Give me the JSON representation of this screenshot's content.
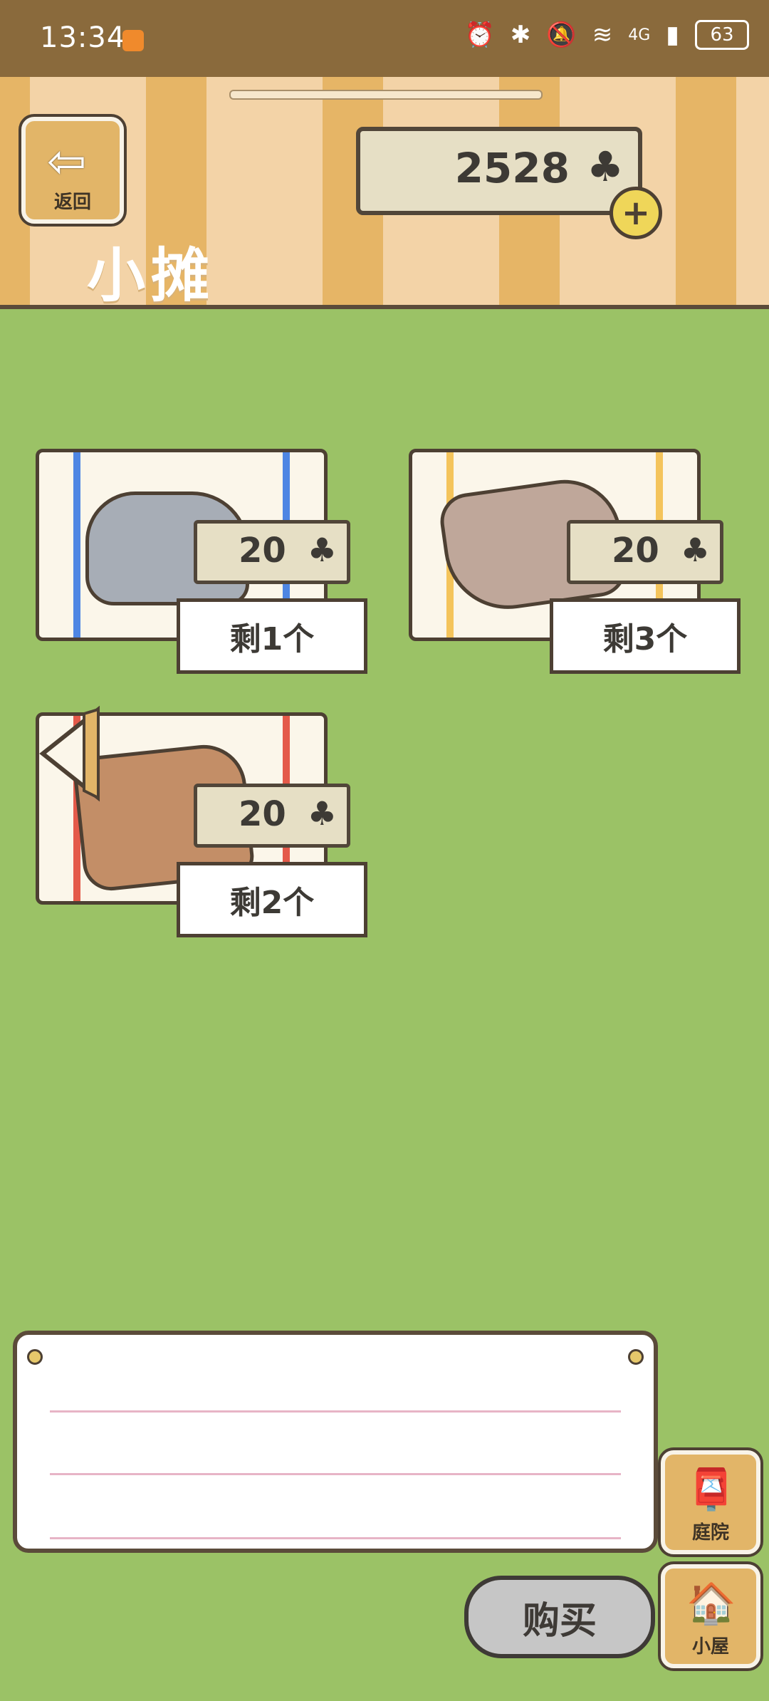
{
  "status_bar": {
    "time": "13:34",
    "network": "4G",
    "battery": "63",
    "icons": [
      "alarm-icon",
      "bluetooth-icon",
      "mute-icon",
      "wifi-icon",
      "signal-icon"
    ]
  },
  "header": {
    "back_label": "返回",
    "title": "小摊",
    "currency_value": "2528",
    "currency_icon": "♣",
    "add_icon": "+"
  },
  "items": [
    {
      "price": "20",
      "stock": "剩1个",
      "cloth_stripe_color": "#4e86e3",
      "object_color": "#a7adb6"
    },
    {
      "price": "20",
      "stock": "剩3个",
      "cloth_stripe_color": "#f4c45b",
      "object_color": "#bfa79a"
    },
    {
      "price": "20",
      "stock": "剩2个",
      "cloth_stripe_color": "#e45a4a",
      "object_color": "#c38e67"
    }
  ],
  "buttons": {
    "buy": "购买",
    "yard": "庭院",
    "house": "小屋"
  },
  "colors": {
    "grass": "#9bc266",
    "stripe_dark": "#e6b566",
    "stripe_light": "#f3d3a7",
    "board_lines": "#e7b4c6"
  }
}
